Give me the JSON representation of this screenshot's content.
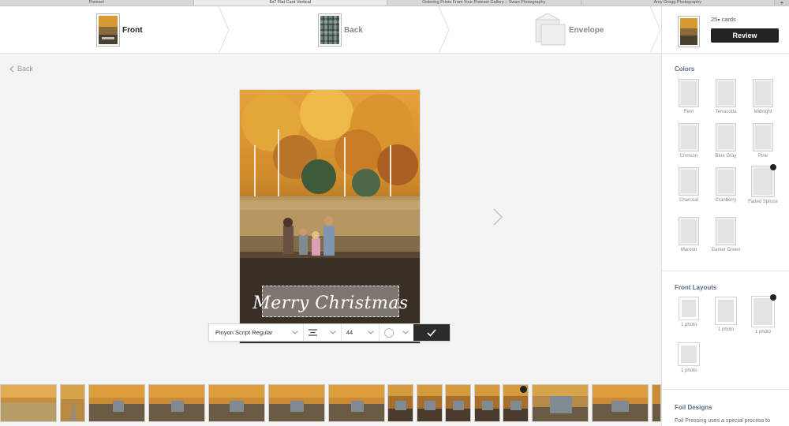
{
  "browser_tabs": [
    {
      "label": "Pixieset",
      "active": false
    },
    {
      "label": "5x7 Flat Card Vertical",
      "active": true
    },
    {
      "label": "Ordering Prints From Your Pixieset Gallery – Swan Photography",
      "active": false
    },
    {
      "label": "Amy Gregg Photography",
      "active": false
    }
  ],
  "new_tab_label": "+",
  "steps": {
    "front": "Front",
    "back": "Back",
    "envelope": "Envelope"
  },
  "review": {
    "count": "25",
    "count_suffix": "cards",
    "button": "Review"
  },
  "back_link": "Back",
  "card": {
    "greeting": "Merry Christmas"
  },
  "toolbar": {
    "font": "Pinyon Script Regular",
    "size": "44",
    "text_color": "#ffffff"
  },
  "sidebar": {
    "colors_title": "Colors",
    "colors": [
      {
        "name": "Fern",
        "selected": false
      },
      {
        "name": "Terracotta",
        "selected": false
      },
      {
        "name": "Midnight",
        "selected": false
      },
      {
        "name": "Crimson",
        "selected": false
      },
      {
        "name": "Blue Gray",
        "selected": false
      },
      {
        "name": "Pine",
        "selected": false
      },
      {
        "name": "Charcoal",
        "selected": false
      },
      {
        "name": "Cranberry",
        "selected": false
      },
      {
        "name": "Faded Spruce",
        "selected": true
      },
      {
        "name": "Maroon",
        "selected": false
      },
      {
        "name": "Darker Green",
        "selected": false
      }
    ],
    "layouts_title": "Front Layouts",
    "layouts": [
      {
        "name": "1 photo",
        "selected": false
      },
      {
        "name": "1 photo",
        "selected": false
      },
      {
        "name": "1 photo",
        "selected": true
      },
      {
        "name": "1 photo",
        "selected": false
      }
    ],
    "foil_title": "Foil Designs",
    "foil_description": "Foil Pressing uses a special process to"
  },
  "accent_color": "#222222"
}
